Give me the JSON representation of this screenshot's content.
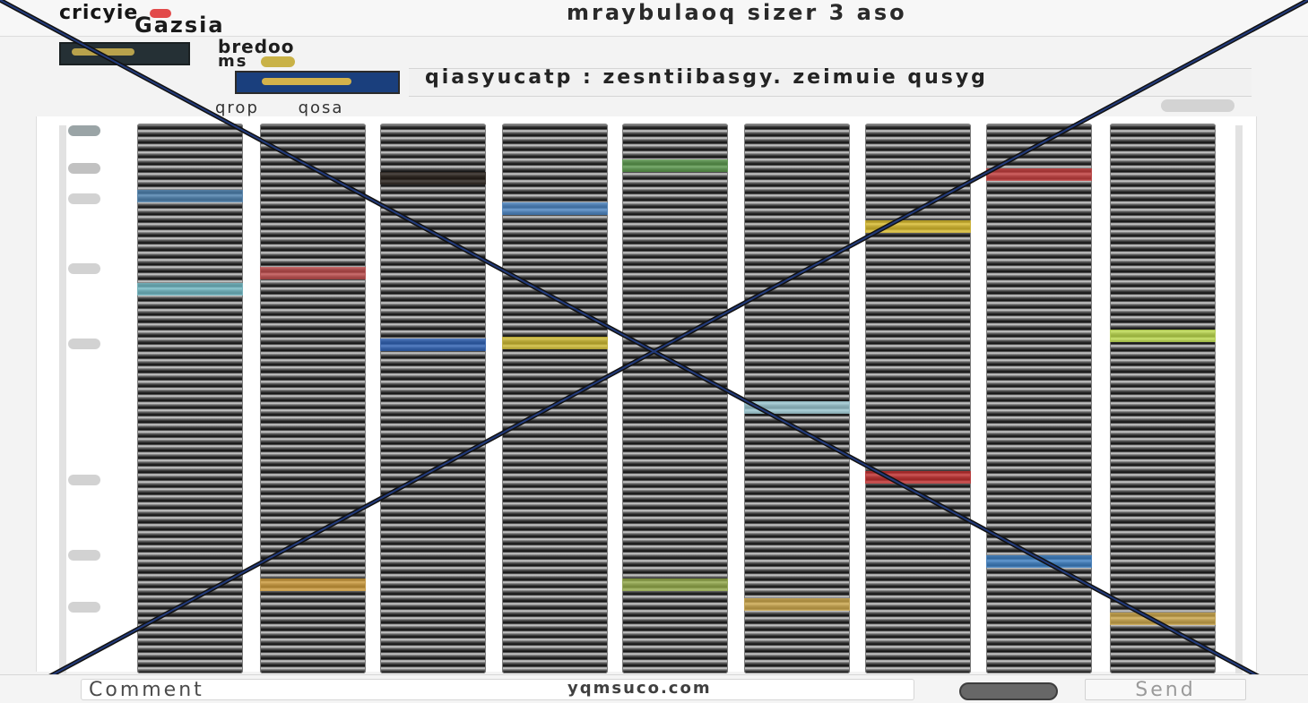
{
  "header": {
    "brand_text": "cricyie",
    "site_label": "Gazsia",
    "title": "mraybulaoq sizer 3 aso"
  },
  "info": {
    "title_line": "bredoo",
    "meta_line": "ms"
  },
  "subtitle": {
    "text": "qiasyucatp : zesntiibasgy. zeimuie qusyg"
  },
  "tabs": [
    {
      "label": "qrop"
    },
    {
      "label": "qosa"
    }
  ],
  "footer": {
    "comment_placeholder": "Comment",
    "url_text": "yqmsuco.com",
    "send_label": "Send"
  },
  "colors": {
    "background": "#f3f3f3",
    "header": "#f7f7f7",
    "accent_blue": "#1a3f7d",
    "accent_gold": "#d3b24b",
    "line_black": "#111111",
    "line_navy": "#223a7a"
  },
  "icons": {
    "brand": "red-oval-icon",
    "logo": "logo-tile-icon",
    "send": "send-icon"
  }
}
